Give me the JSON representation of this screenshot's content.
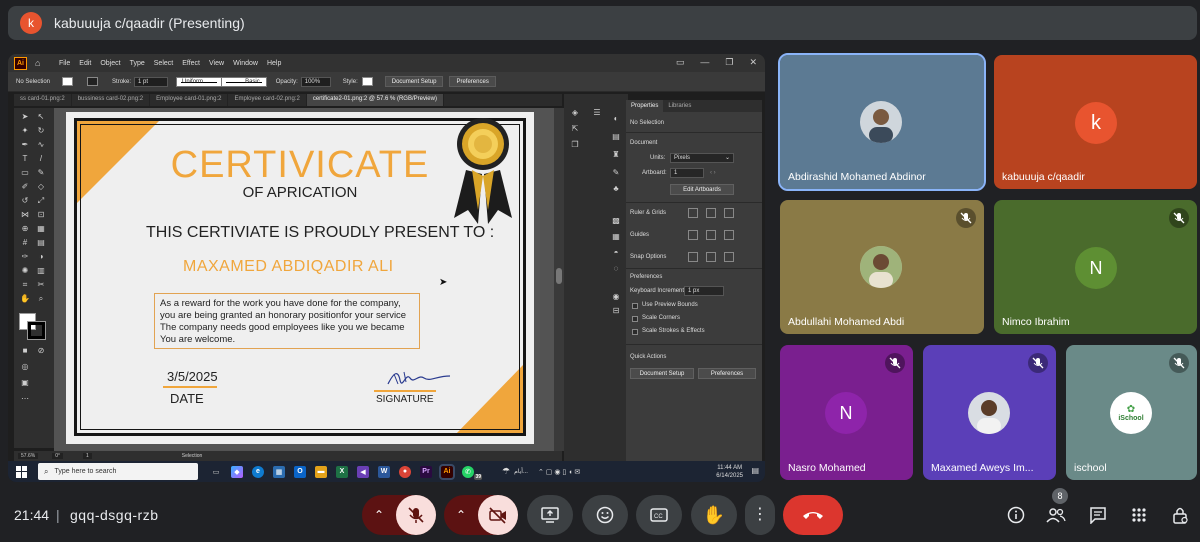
{
  "presenter": {
    "avatar_letter": "k",
    "title": "kabuuuja c/qaadir (Presenting)"
  },
  "illustrator": {
    "menus": [
      "File",
      "Edit",
      "Object",
      "Type",
      "Select",
      "Effect",
      "View",
      "Window",
      "Help"
    ],
    "control_bar": {
      "no_selection": "No Selection",
      "stroke_label": "Stroke:",
      "stroke_value": "1 pt",
      "uniform": "Uniform",
      "basic": "Basic",
      "opacity_label": "Opacity:",
      "opacity_value": "100%",
      "style_label": "Style:",
      "document_setup": "Document Setup",
      "preferences": "Preferences"
    },
    "tabs": [
      "ss card-01.png:2",
      "bussiness card-02.png:2",
      "Employee card-01.png:2",
      "Employee card-02.png:2",
      "certificate2-01.png:2 @ 57.6 % (RGB/Preview)"
    ],
    "status": {
      "zoom": "57.6%",
      "angle": "0°",
      "artboard": "1",
      "tool": "Selection"
    },
    "panel": {
      "tab_properties": "Properties",
      "tab_libraries": "Libraries",
      "no_selection": "No Selection",
      "document": "Document",
      "units_label": "Units:",
      "units_value": "Pixels",
      "artboard_label": "Artboard:",
      "artboard_value": "1",
      "edit_artboards": "Edit Artboards",
      "ruler_grids": "Ruler & Grids",
      "guides": "Guides",
      "snap_options": "Snap Options",
      "preferences": "Preferences",
      "keyboard_increment_label": "Keyboard Increment:",
      "keyboard_increment_value": "1 px",
      "use_preview_bounds": "Use Preview Bounds",
      "scale_corners": "Scale Corners",
      "scale_strokes": "Scale Strokes & Effects",
      "quick_actions": "Quick Actions",
      "document_setup": "Document Setup",
      "preferences_btn": "Preferences"
    }
  },
  "certificate": {
    "title": "CERTIVICATE",
    "subtitle": "OF APRICATION",
    "present_line": "THIS CERTIVIATE IS PROUDLY PRESENT TO :",
    "recipient": "MAXAMED ABDIQADIR ALI",
    "body_lines": [
      "As a reward for the work you have done for the company,",
      "you are being granted an honorary positionfor your service",
      "The company needs good employees like you we became",
      "You are welcome."
    ],
    "date_value": "3/5/2025",
    "date_label": "DATE",
    "signature_label": "SIGNATURE",
    "colors": {
      "accent": "#f0a63c",
      "frame": "#151515"
    }
  },
  "taskbar": {
    "search_placeholder": "Type here to search",
    "time": "11:44 AM",
    "date": "6/14/2025",
    "weather_text": "أيام...",
    "badge": "39"
  },
  "participants": [
    {
      "name": "Abdirashid Mohamed Abdinor",
      "muted": false,
      "active_speaker": true,
      "bg": "#5c7a93",
      "avatar": "photo"
    },
    {
      "name": "kabuuuja c/qaadir",
      "muted": false,
      "active_speaker": false,
      "bg": "#b8431f",
      "avatar_letter": "k",
      "avatar_color": "#e8542f"
    },
    {
      "name": "Abdullahi Mohamed Abdi",
      "muted": true,
      "bg": "#8a7a46",
      "avatar": "photo"
    },
    {
      "name": "Nimco Ibrahim",
      "muted": true,
      "bg": "#4a6b2c",
      "avatar_letter": "N",
      "avatar_color": "#5e8f33"
    },
    {
      "name": "Nasro Mohamed",
      "muted": true,
      "bg": "#7a1f8f",
      "avatar_letter": "N",
      "avatar_color": "#8e24aa"
    },
    {
      "name": "Maxamed Aweys Im...",
      "muted": true,
      "bg": "#5b3fb8",
      "avatar": "photo"
    },
    {
      "name": "ischool",
      "muted": true,
      "bg": "#6a8a88",
      "avatar": "logo",
      "logo_text": "iSchool"
    }
  ],
  "bottom_bar": {
    "time": "21:44",
    "separator": "|",
    "meeting_code": "gqq-dsgq-rzb",
    "people_count": "8"
  }
}
